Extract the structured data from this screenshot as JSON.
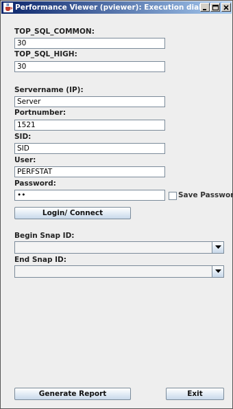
{
  "window": {
    "title": "Performance Viewer (pviewer): Execution dialog"
  },
  "form": {
    "top_sql_common": {
      "label": "TOP_SQL_COMMON:",
      "value": "30"
    },
    "top_sql_high": {
      "label": "TOP_SQL_HIGH:",
      "value": "30"
    },
    "servername": {
      "label": "Servername (IP):",
      "value": "Server"
    },
    "portnumber": {
      "label": "Portnumber:",
      "value": "1521"
    },
    "sid": {
      "label": "SID:",
      "value": "SID"
    },
    "user": {
      "label": "User:",
      "value": "PERFSTAT"
    },
    "password": {
      "label": "Password:",
      "value": "••"
    },
    "save_password": {
      "label": "Save Password",
      "checked": false
    },
    "login_button": "Login/ Connect",
    "begin_snap": {
      "label": "Begin Snap ID:",
      "value": ""
    },
    "end_snap": {
      "label": "End Snap ID:",
      "value": ""
    }
  },
  "footer": {
    "generate_button": "Generate Report",
    "exit_button": "Exit"
  },
  "icons": {
    "app": "java-cup-icon",
    "minimize": "minimize-icon",
    "maximize": "maximize-icon",
    "close": "close-icon",
    "dropdown": "chevron-down-icon"
  },
  "colors": {
    "titlebar_start": "#0a246a",
    "titlebar_end": "#a6caf0",
    "window_bg": "#eeeeee"
  }
}
